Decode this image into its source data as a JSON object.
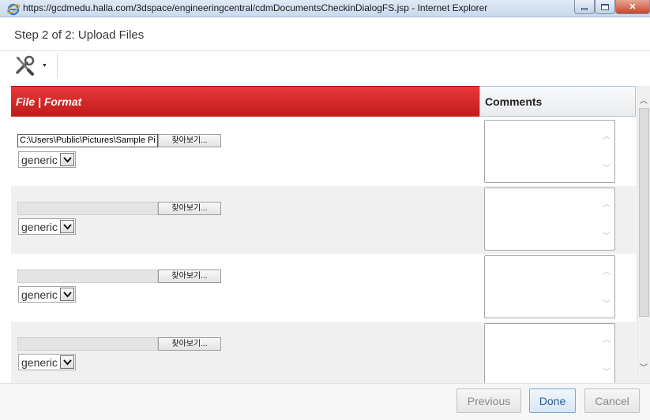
{
  "window": {
    "title": "https://gcdmedu.halla.com/3dspace/engineeringcentral/cdmDocumentsCheckinDialogFS.jsp - Internet Explorer",
    "close_glyph": "✕"
  },
  "dialog": {
    "step_title": "Step 2 of 2: Upload Files",
    "toolbar_icon": "tools-icon"
  },
  "table": {
    "header_file": "File | Format",
    "header_comments": "Comments",
    "rows": [
      {
        "file_value": "C:\\Users\\Public\\Pictures\\Sample Pi",
        "browse_label": "찾아보기...",
        "format": "generic",
        "comment": ""
      },
      {
        "file_value": "",
        "browse_label": "찾아보기...",
        "format": "generic",
        "comment": ""
      },
      {
        "file_value": "",
        "browse_label": "찾아보기...",
        "format": "generic",
        "comment": ""
      },
      {
        "file_value": "",
        "browse_label": "찾아보기...",
        "format": "generic",
        "comment": ""
      }
    ]
  },
  "footer": {
    "previous_label": "Previous",
    "done_label": "Done",
    "cancel_label": "Cancel"
  },
  "colors": {
    "header_red": "#d42a2a",
    "done_blue": "#2a5d8e"
  }
}
